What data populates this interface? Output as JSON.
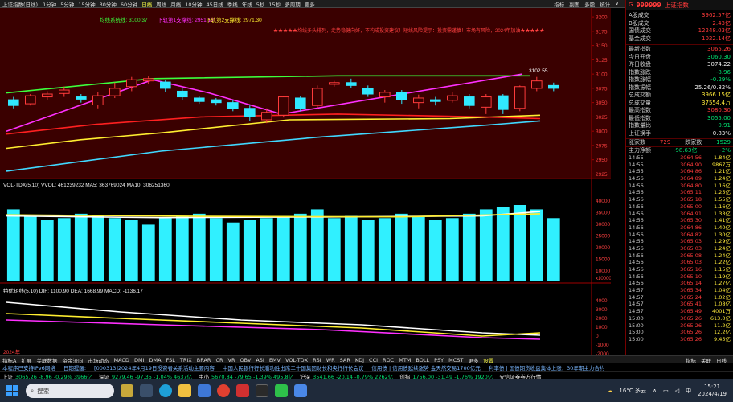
{
  "toolbar": {
    "title": "上证指数(日线)",
    "periods": [
      "1分钟",
      "5分钟",
      "15分钟",
      "30分钟",
      "60分钟",
      "日线",
      "周线",
      "月线",
      "10分钟",
      "45日线",
      "季线",
      "年线",
      "5秒",
      "15秒",
      "多周期",
      "更多"
    ],
    "selected": "日线",
    "right": [
      "指标",
      "副图",
      "多股",
      "统计",
      "∨"
    ]
  },
  "main_chart": {
    "legend_ma": "均线系统线: 3100.37",
    "legend_ma2": "下轨第1支撑线: 2951.19",
    "legend_ma3": "下轨第2支撑线: 2971.30",
    "alert_text": "★★★★★均线多头排列，走势稳健向好，不构成投资建议！短线风险提示：投资需谨慎！市场有风险，2024年加油★★★★★",
    "last_label": "3102.55",
    "y_ticks": [
      "3200",
      "3175",
      "3150",
      "3125",
      "3100",
      "3075",
      "3050",
      "3025",
      "3000",
      "2975",
      "2950",
      "2925"
    ]
  },
  "volume_chart": {
    "legend": "VOL-TDX(5,10)  VVOL: 461239232  MA5: 363769024  MA10: 306251360",
    "y_ticks": [
      "40000",
      "35000",
      "30000",
      "25000",
      "20000",
      "15000",
      "10000"
    ],
    "unit": "x10000"
  },
  "macd_chart": {
    "legend": "特优短线(5,10)  DIF: 1100.90  DEA: 1668.99  MACD: -1136.17",
    "y_ticks": [
      "4000",
      "3000",
      "2000",
      "1000",
      "0",
      "-1000",
      "-2000"
    ],
    "year_label": "2024年"
  },
  "chart_data": {
    "type": "candlestick",
    "candles": [
      {
        "o": 3055,
        "c": 3045,
        "h": 3060,
        "l": 3040
      },
      {
        "o": 3048,
        "c": 3062,
        "h": 3065,
        "l": 3045
      },
      {
        "o": 3060,
        "c": 3065,
        "h": 3070,
        "l": 3055
      },
      {
        "o": 3066,
        "c": 3072,
        "h": 3078,
        "l": 3060
      },
      {
        "o": 3060,
        "c": 3056,
        "h": 3065,
        "l": 3050
      },
      {
        "o": 3046,
        "c": 3062,
        "h": 3068,
        "l": 3040
      },
      {
        "o": 3062,
        "c": 3075,
        "h": 3085,
        "l": 3058
      },
      {
        "o": 3078,
        "c": 3090,
        "h": 3095,
        "l": 3070
      },
      {
        "o": 3088,
        "c": 3092,
        "h": 3097,
        "l": 3082
      },
      {
        "o": 3086,
        "c": 3075,
        "h": 3090,
        "l": 3068
      },
      {
        "o": 3070,
        "c": 3060,
        "h": 3075,
        "l": 3055
      },
      {
        "o": 3058,
        "c": 3052,
        "h": 3062,
        "l": 3048
      },
      {
        "o": 3055,
        "c": 3050,
        "h": 3058,
        "l": 3045
      },
      {
        "o": 3050,
        "c": 3040,
        "h": 3055,
        "l": 3035
      },
      {
        "o": 3040,
        "c": 3025,
        "h": 3045,
        "l": 3018
      },
      {
        "o": 3020,
        "c": 3033,
        "h": 3040,
        "l": 3014
      },
      {
        "o": 3028,
        "c": 3060,
        "h": 3062,
        "l": 3024
      },
      {
        "o": 3058,
        "c": 3040,
        "h": 3062,
        "l": 3035
      },
      {
        "o": 3045,
        "c": 3075,
        "h": 3080,
        "l": 3040
      },
      {
        "o": 3082,
        "c": 3085,
        "h": 3088,
        "l": 3078
      },
      {
        "o": 3085,
        "c": 3080,
        "h": 3092,
        "l": 3075
      },
      {
        "o": 3075,
        "c": 3065,
        "h": 3080,
        "l": 3060
      },
      {
        "o": 3060,
        "c": 3068,
        "h": 3072,
        "l": 3050
      },
      {
        "o": 3068,
        "c": 3055,
        "h": 3072,
        "l": 3048
      },
      {
        "o": 3050,
        "c": 3058,
        "h": 3064,
        "l": 3040
      },
      {
        "o": 3055,
        "c": 3052,
        "h": 3060,
        "l": 3045
      },
      {
        "o": 3054,
        "c": 3062,
        "h": 3068,
        "l": 3050
      },
      {
        "o": 3060,
        "c": 3045,
        "h": 3065,
        "l": 3040
      },
      {
        "o": 3042,
        "c": 3060,
        "h": 3065,
        "l": 3030
      },
      {
        "o": 3062,
        "c": 3038,
        "h": 3065,
        "l": 3030
      },
      {
        "o": 3040,
        "c": 3078,
        "h": 3080,
        "l": 3035
      },
      {
        "o": 3075,
        "c": 3088,
        "h": 3095,
        "l": 3070
      },
      {
        "o": 3080,
        "c": 3075,
        "h": 3085,
        "l": 3070
      }
    ],
    "volumes": [
      330,
      300,
      280,
      290,
      310,
      300,
      290,
      280,
      260,
      290,
      300,
      310,
      290,
      270,
      280,
      290,
      300,
      310,
      330,
      290,
      300,
      280,
      290,
      310,
      300,
      280,
      290,
      310,
      330,
      340,
      350,
      330,
      290
    ],
    "ylim": [
      2920,
      3210
    ],
    "vol_ylim": [
      0,
      420
    ]
  },
  "right_panel": {
    "code": "999999",
    "name": "上证指数",
    "stats": [
      {
        "label": "A股成交",
        "value": "3962.57亿",
        "cls": "red"
      },
      {
        "label": "B股成交",
        "value": "2.43亿",
        "cls": "red"
      },
      {
        "label": "国债成交",
        "value": "12248.03亿",
        "cls": "red"
      },
      {
        "label": "基金成交",
        "value": "1022.14亿",
        "cls": "red"
      }
    ],
    "quote": [
      {
        "label": "最新指数",
        "value": "3065.26",
        "cls": "red"
      },
      {
        "label": "今日开盘",
        "value": "3060.30",
        "cls": "grn"
      },
      {
        "label": "昨日收盘",
        "value": "3074.22",
        "cls": "wht"
      },
      {
        "label": "指数涨跌",
        "value": "-8.96",
        "cls": "grn"
      },
      {
        "label": "指数涨幅",
        "value": "-0.29%",
        "cls": "grn"
      },
      {
        "label": "指数振幅",
        "value": "25.26/0.82%",
        "cls": "wht"
      },
      {
        "label": "总成交额",
        "value": "3966.15亿",
        "cls": "yel"
      },
      {
        "label": "总成交量",
        "value": "37554.4万",
        "cls": "yel"
      },
      {
        "label": "最高指数",
        "value": "3080.30",
        "cls": "red"
      },
      {
        "label": "最低指数",
        "value": "3055.00",
        "cls": "grn"
      },
      {
        "label": "指数量比",
        "value": "0.91",
        "cls": "grn"
      },
      {
        "label": "上证换手",
        "value": "0.83%",
        "cls": "wht"
      }
    ],
    "updown": {
      "up_label": "涨家数",
      "up": "729",
      "down_label": "跌家数",
      "down": "1529"
    },
    "net": {
      "label": "主力净额",
      "value": "-98.63亿",
      "extra": "-2%"
    },
    "ticks": [
      {
        "t": "14:55",
        "p": "3064.56",
        "v": "1.84亿"
      },
      {
        "t": "14:55",
        "p": "3064.90",
        "v": "9867万"
      },
      {
        "t": "14:55",
        "p": "3064.86",
        "v": "1.21亿"
      },
      {
        "t": "14:56",
        "p": "3064.89",
        "v": "1.24亿"
      },
      {
        "t": "14:56",
        "p": "3064.80",
        "v": "1.16亿"
      },
      {
        "t": "14:56",
        "p": "3065.11",
        "v": "1.25亿"
      },
      {
        "t": "14:56",
        "p": "3065.18",
        "v": "1.55亿"
      },
      {
        "t": "14:56",
        "p": "3065.00",
        "v": "1.16亿"
      },
      {
        "t": "14:56",
        "p": "3064.91",
        "v": "1.33亿"
      },
      {
        "t": "14:56",
        "p": "3065.30",
        "v": "1.41亿"
      },
      {
        "t": "14:56",
        "p": "3064.86",
        "v": "1.40亿"
      },
      {
        "t": "14:56",
        "p": "3064.82",
        "v": "1.30亿"
      },
      {
        "t": "14:56",
        "p": "3065.03",
        "v": "1.29亿"
      },
      {
        "t": "14:56",
        "p": "3065.03",
        "v": "1.24亿"
      },
      {
        "t": "14:56",
        "p": "3065.08",
        "v": "1.24亿"
      },
      {
        "t": "14:56",
        "p": "3065.03",
        "v": "1.22亿"
      },
      {
        "t": "14:56",
        "p": "3065.16",
        "v": "1.15亿"
      },
      {
        "t": "14:56",
        "p": "3065.10",
        "v": "1.19亿"
      },
      {
        "t": "14:56",
        "p": "3065.14",
        "v": "1.27亿"
      },
      {
        "t": "14:57",
        "p": "3065.34",
        "v": "1.04亿"
      },
      {
        "t": "14:57",
        "p": "3065.24",
        "v": "1.02亿"
      },
      {
        "t": "14:57",
        "p": "3065.41",
        "v": "1.08亿"
      },
      {
        "t": "14:57",
        "p": "3065.49",
        "v": "4001万"
      },
      {
        "t": "15:00",
        "p": "3065.26",
        "v": "613.0亿"
      },
      {
        "t": "15:00",
        "p": "3065.26",
        "v": "11.2亿"
      },
      {
        "t": "15:00",
        "p": "3065.26",
        "v": "12.2亿"
      },
      {
        "t": "15:00",
        "p": "3065.26",
        "v": "9.45亿"
      }
    ]
  },
  "indicator_tabs": {
    "items": [
      "指标A",
      "扩展",
      "关联数据",
      "资金流向",
      "市场动态",
      "MACD",
      "DMI",
      "DMA",
      "FSL",
      "TRIX",
      "BRAR",
      "CR",
      "VR",
      "OBV",
      "ASI",
      "EMV",
      "VOL-TDX",
      "RSI",
      "WR",
      "SAR",
      "KDJ",
      "CCI",
      "ROC",
      "MTM",
      "BOLL",
      "PSY",
      "MCST",
      "更多",
      "设置"
    ],
    "right": [
      "指标",
      "关联",
      "日线"
    ]
  },
  "ticker_news": [
    "本程序已支持IPv6网络",
    "日期提醒:",
    "[000313]2024年4月19日投资者关系活动主要内容",
    "中国人民银行行长潘功胜出席二十国集团财长和央行行长会议",
    "信用债 | 信用债延续涨势 金天然交易1700亿元",
    "利率债 | 国债期货收盘集体上涨，30年期主力合约"
  ],
  "ticker_indices": [
    {
      "name": "上证",
      "value": "3065.26  -8.96  -0.29%  3966亿",
      "cls": "grn"
    },
    {
      "name": "深证",
      "value": "9279.46  -97.35  -1.04%  4637亿",
      "cls": "grn"
    },
    {
      "name": "中小",
      "value": "5670.84  -79.65  -1.39%  495.8亿",
      "cls": "grn"
    },
    {
      "name": "沪深",
      "value": "3541.66  -20.14  -0.79%  2262亿",
      "cls": "grn"
    },
    {
      "name": "创指",
      "value": "1756.00  -31.49  -1.76%  1920亿",
      "cls": "grn"
    },
    {
      "name": "",
      "value": "安信证券券方行情",
      "cls": "wht"
    }
  ],
  "taskbar": {
    "search_placeholder": "搜索",
    "weather": "16°C 多云",
    "time": "15:21",
    "date": "2024/4/19"
  },
  "colors": {
    "up": "#ff3b3b",
    "down": "#00e0ff",
    "ma_green": "#3cff3c",
    "ma_magenta": "#ff30ff",
    "ma_yellow": "#ffee30",
    "ma_red": "#ff2020",
    "vol_bar": "#30f0ff"
  }
}
